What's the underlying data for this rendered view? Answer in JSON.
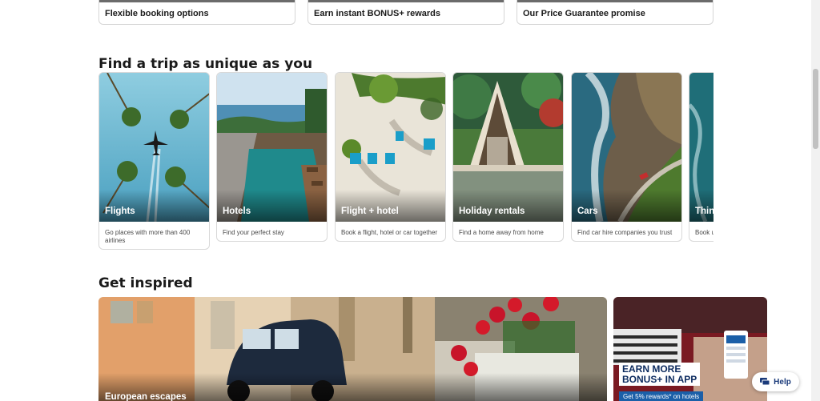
{
  "features": [
    {
      "label": "Flexible booking options"
    },
    {
      "label": "Earn instant BONUS+ rewards"
    },
    {
      "label": "Our Price Guarantee promise"
    }
  ],
  "trips": {
    "heading": "Find a trip as unique as you",
    "cards": [
      {
        "title": "Flights",
        "desc": "Go places with more than 400 airlines"
      },
      {
        "title": "Hotels",
        "desc": "Find your perfect stay"
      },
      {
        "title": "Flight + hotel",
        "desc": "Book a flight, hotel or car together"
      },
      {
        "title": "Holiday rentals",
        "desc": "Find a home away from home"
      },
      {
        "title": "Cars",
        "desc": "Find car hire companies you trust"
      },
      {
        "title": "Thin",
        "desc": "Book u"
      }
    ]
  },
  "inspired": {
    "heading": "Get inspired",
    "main_label": "European escapes",
    "promo": {
      "headline_1": "EARN MORE",
      "headline_2": "BONUS+ IN APP",
      "sub": "Get 5% rewards* on hotels"
    }
  },
  "help": {
    "label": "Help"
  },
  "colors": {
    "accent": "#1a3a7a",
    "promo_blue": "#1b5fa8"
  }
}
